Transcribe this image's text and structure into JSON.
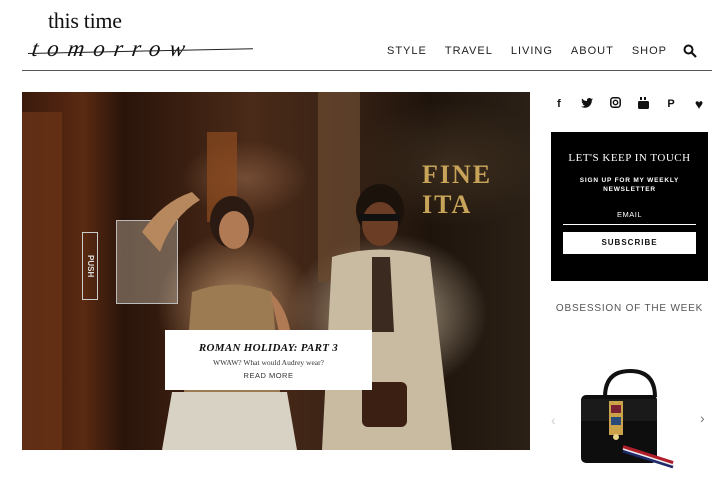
{
  "brand": {
    "top": "this time",
    "script": "tomorrow"
  },
  "nav": {
    "items": [
      "STYLE",
      "TRAVEL",
      "LIVING",
      "ABOUT",
      "SHOP"
    ],
    "search_icon": "search-icon"
  },
  "hero": {
    "sign_text": "FINE ITA",
    "door_sign": "PUSH",
    "caption": {
      "title": "ROMAN HOLIDAY: PART 3",
      "subtitle": "WWAW? What would Audrey wear?",
      "read_more": "READ MORE"
    }
  },
  "social": {
    "icons": [
      "facebook-icon",
      "twitter-icon",
      "instagram-icon",
      "youtube-icon",
      "pinterest-icon",
      "heart-icon"
    ],
    "glyphs": [
      "f",
      "❧",
      "▣",
      "▶",
      "P",
      "♥"
    ]
  },
  "newsletter": {
    "title": "LET'S KEEP IN TOUCH",
    "subtitle": "SIGN UP FOR MY WEEKLY NEWSLETTER",
    "email_placeholder": "EMAIL",
    "subscribe_label": "SUBSCRIBE"
  },
  "obsession": {
    "title": "OBSESSION OF THE WEEK",
    "prev": "‹",
    "next": "›"
  }
}
